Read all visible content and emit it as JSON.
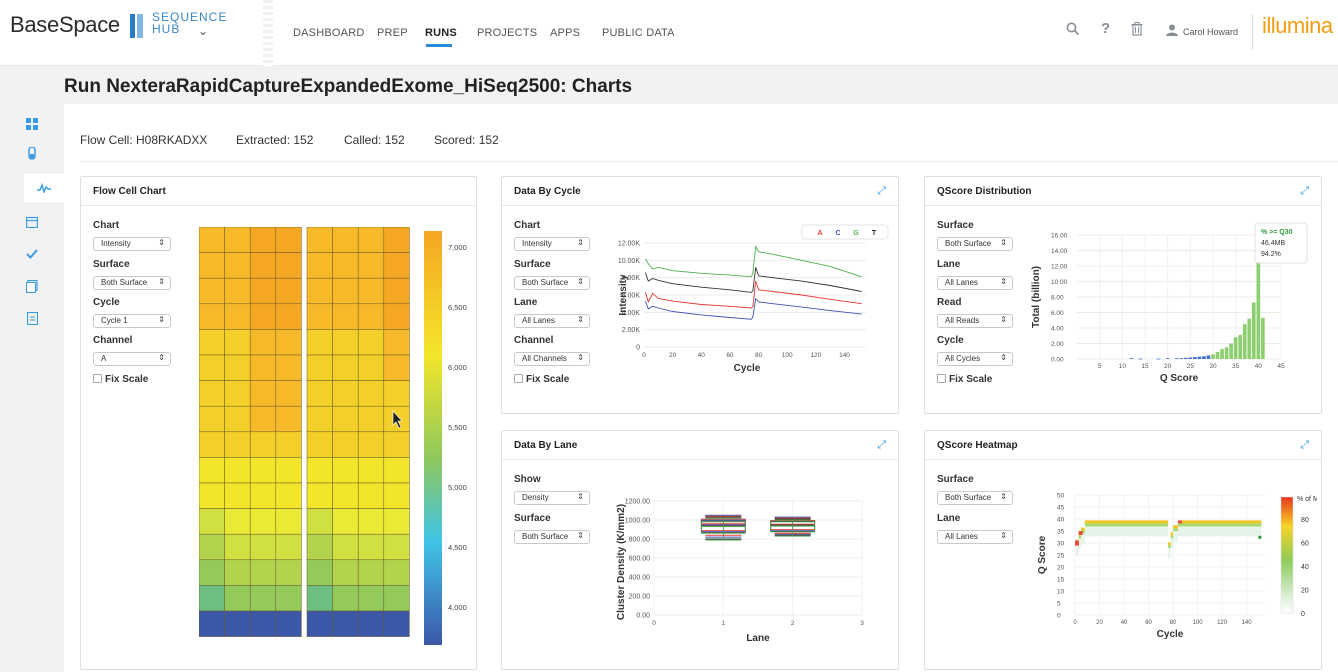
{
  "app": {
    "logo_text": "BaseSpace",
    "hub_line1": "SEQUENCE",
    "hub_line2": "HUB",
    "brand": "illumina",
    "nav": [
      "DASHBOARD",
      "PREP",
      "RUNS",
      "PROJECTS",
      "APPS",
      "PUBLIC DATA"
    ],
    "active_nav": "RUNS",
    "user": "Carol Howard"
  },
  "page": {
    "title": "Run NexteraRapidCaptureExpandedExome_HiSeq2500: Charts",
    "meta": {
      "flow_cell": "Flow Cell: H08RKADXX",
      "extracted": "Extracted: 152",
      "called": "Called: 152",
      "scored": "Scored: 152"
    }
  },
  "flow_cell_chart": {
    "title": "Flow Cell Chart",
    "labels": {
      "chart": "Chart",
      "surface": "Surface",
      "cycle": "Cycle",
      "channel": "Channel",
      "fix_scale": "Fix Scale"
    },
    "values": {
      "chart": "Intensity",
      "surface": "Both Surface",
      "cycle": "Cycle 1",
      "channel": "A"
    },
    "scale_ticks": [
      "7,000",
      "6,500",
      "6,000",
      "5,500",
      "5,000",
      "4,500",
      "4,000"
    ],
    "colors": {
      "high": "#f5a623",
      "mid": "#f3e62a",
      "low_mid": "#8fc85c",
      "low": "#3b57a8"
    }
  },
  "data_by_cycle": {
    "title": "Data By Cycle",
    "labels": {
      "chart": "Chart",
      "surface": "Surface",
      "lane": "Lane",
      "channel": "Channel",
      "fix_scale": "Fix Scale"
    },
    "values": {
      "chart": "Intensity",
      "surface": "Both Surface",
      "lane": "All Lanes",
      "channel": "All Channels"
    }
  },
  "qscore_distribution": {
    "title": "QScore Distribution",
    "labels": {
      "surface": "Surface",
      "lane": "Lane",
      "read": "Read",
      "cycle": "Cycle",
      "fix_scale": "Fix Scale"
    },
    "values": {
      "surface": "Both Surface",
      "lane": "All Lanes",
      "read": "All Reads",
      "cycle": "All Cycles"
    },
    "tooltip": {
      "label": "% >= Q30",
      "value1": "46.4MB",
      "value2": "94.2%"
    }
  },
  "data_by_lane": {
    "title": "Data By Lane",
    "labels": {
      "show": "Show",
      "surface": "Surface"
    },
    "values": {
      "show": "Density",
      "surface": "Both Surface"
    }
  },
  "qscore_heatmap": {
    "title": "QScore Heatmap",
    "labels": {
      "surface": "Surface",
      "lane": "Lane"
    },
    "values": {
      "surface": "Both Surface",
      "lane": "All Lanes"
    }
  },
  "chart_data": [
    {
      "type": "line",
      "id": "data_by_cycle",
      "xlabel": "Cycle",
      "ylabel": "Intensity",
      "xlim": [
        0,
        155
      ],
      "ylim": [
        0,
        12000
      ],
      "x_ticks": [
        "0",
        "20",
        "40",
        "60",
        "80",
        "100",
        "120",
        "140"
      ],
      "y_ticks": [
        "0",
        "2.00K",
        "4.00K",
        "6.00K",
        "8.00K",
        "10.00K",
        "12.00K"
      ],
      "legend": [
        "A",
        "C",
        "G",
        "T"
      ],
      "series": [
        {
          "name": "G",
          "color": "#4caf50",
          "x": [
            1,
            3,
            6,
            10,
            20,
            40,
            60,
            75,
            76,
            78,
            80,
            90,
            110,
            130,
            152
          ],
          "y": [
            10200,
            9600,
            9000,
            9200,
            8800,
            8500,
            8300,
            8100,
            8600,
            11600,
            11000,
            10700,
            10000,
            9300,
            8100
          ]
        },
        {
          "name": "T",
          "color": "#333333",
          "x": [
            1,
            3,
            6,
            10,
            20,
            40,
            60,
            75,
            76,
            78,
            80,
            90,
            110,
            130,
            152
          ],
          "y": [
            8600,
            7600,
            7900,
            7700,
            7300,
            6900,
            6600,
            6300,
            6500,
            9200,
            8200,
            8000,
            7600,
            7100,
            6400
          ]
        },
        {
          "name": "A",
          "color": "#e53935",
          "x": [
            1,
            3,
            6,
            10,
            20,
            40,
            60,
            75,
            76,
            78,
            80,
            90,
            110,
            130,
            152
          ],
          "y": [
            6300,
            5200,
            6200,
            5600,
            5300,
            4900,
            4700,
            4500,
            4700,
            7600,
            6600,
            6400,
            6000,
            5500,
            5000
          ]
        },
        {
          "name": "C",
          "color": "#3f51b5",
          "x": [
            1,
            3,
            6,
            10,
            20,
            40,
            60,
            75,
            76,
            78,
            80,
            90,
            110,
            130,
            152
          ],
          "y": [
            5300,
            4400,
            4700,
            4500,
            4100,
            3700,
            3400,
            3200,
            3500,
            5600,
            5200,
            5000,
            4600,
            4200,
            3800
          ]
        }
      ]
    },
    {
      "type": "bar",
      "id": "qscore_distribution",
      "xlabel": "Q Score",
      "ylabel": "Total (billion)",
      "xlim": [
        0,
        45
      ],
      "ylim": [
        0,
        16
      ],
      "x_ticks": [
        "5",
        "10",
        "15",
        "20",
        "25",
        "30",
        "35",
        "40",
        "45"
      ],
      "y_ticks": [
        "0.00",
        "2.00",
        "4.00",
        "6.00",
        "8.00",
        "10.00",
        "12.00",
        "14.00",
        "16.00"
      ],
      "x": [
        12,
        14,
        18,
        20,
        22,
        23,
        24,
        25,
        26,
        27,
        28,
        29,
        30,
        31,
        32,
        33,
        34,
        35,
        36,
        37,
        38,
        39,
        40,
        41
      ],
      "values": [
        0.1,
        0.05,
        0.05,
        0.1,
        0.1,
        0.1,
        0.15,
        0.2,
        0.25,
        0.3,
        0.35,
        0.45,
        0.6,
        0.9,
        1.3,
        1.5,
        2.0,
        2.8,
        3.1,
        4.5,
        5.2,
        7.3,
        14.0,
        5.3
      ],
      "highlight_from": 30
    },
    {
      "type": "box",
      "id": "data_by_lane",
      "xlabel": "Lane",
      "ylabel": "Cluster Density (K/mm2)",
      "xlim": [
        0,
        3
      ],
      "ylim": [
        0,
        1200
      ],
      "x_ticks": [
        "0",
        "1",
        "2",
        "3"
      ],
      "y_ticks": [
        "0.00",
        "200.00",
        "400.00",
        "600.00",
        "800.00",
        "1000.00",
        "1200.00"
      ],
      "lanes": [
        {
          "lane": 1,
          "series": [
            {
              "color": "#3f51b5",
              "min": 820,
              "q1": 880,
              "median": 950,
              "q3": 1000,
              "max": 1050
            },
            {
              "color": "#e53935",
              "min": 840,
              "q1": 890,
              "median": 960,
              "q3": 1010,
              "max": 1040
            },
            {
              "color": "#333333",
              "min": 800,
              "q1": 870,
              "median": 940,
              "q3": 990,
              "max": 1030
            },
            {
              "color": "#4caf50",
              "min": 790,
              "q1": 860,
              "median": 930,
              "q3": 980,
              "max": 1020
            }
          ]
        },
        {
          "lane": 2,
          "series": [
            {
              "color": "#3f51b5",
              "min": 850,
              "q1": 890,
              "median": 950,
              "q3": 990,
              "max": 1030
            },
            {
              "color": "#e53935",
              "min": 860,
              "q1": 900,
              "median": 955,
              "q3": 995,
              "max": 1020
            },
            {
              "color": "#333333",
              "min": 840,
              "q1": 880,
              "median": 945,
              "q3": 985,
              "max": 1010
            },
            {
              "color": "#4caf50",
              "min": 830,
              "q1": 875,
              "median": 935,
              "q3": 980,
              "max": 1000
            }
          ]
        }
      ]
    },
    {
      "type": "heatmap",
      "id": "qscore_heatmap",
      "xlabel": "Cycle",
      "ylabel": "Q Score",
      "xlim": [
        0,
        155
      ],
      "ylim": [
        0,
        50
      ],
      "x_ticks": [
        "0",
        "20",
        "40",
        "60",
        "80",
        "100",
        "120",
        "140"
      ],
      "y_ticks": [
        "0",
        "5",
        "10",
        "15",
        "20",
        "25",
        "30",
        "35",
        "40",
        "45",
        "50"
      ],
      "colorbar_label": "% of Max",
      "colorbar_ticks": [
        "80",
        "60",
        "40",
        "20",
        "0"
      ],
      "ridge": [
        {
          "x0": 1,
          "x1": 3,
          "q": 31
        },
        {
          "x0": 3,
          "x1": 5,
          "q": 34
        },
        {
          "x0": 5,
          "x1": 8,
          "q": 36
        },
        {
          "x0": 8,
          "x1": 76,
          "q": 39
        },
        {
          "x0": 76,
          "x1": 78,
          "q": 30
        },
        {
          "x0": 78,
          "x1": 80,
          "q": 34
        },
        {
          "x0": 80,
          "x1": 84,
          "q": 37
        },
        {
          "x0": 84,
          "x1": 152,
          "q": 39
        }
      ]
    }
  ]
}
